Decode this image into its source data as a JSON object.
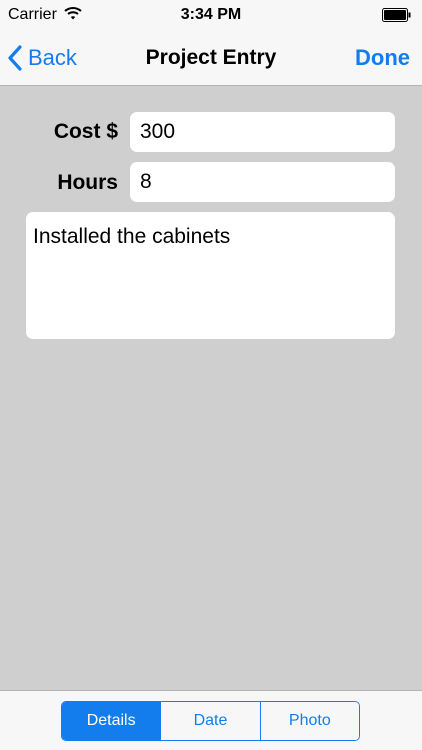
{
  "status_bar": {
    "carrier": "Carrier",
    "time": "3:34 PM",
    "wifi_icon": "wifi-icon",
    "battery_icon": "battery-icon"
  },
  "nav_bar": {
    "back_label": "Back",
    "title": "Project Entry",
    "done_label": "Done"
  },
  "form": {
    "cost": {
      "label": "Cost $",
      "value": "300"
    },
    "hours": {
      "label": "Hours",
      "value": "8"
    },
    "notes": {
      "value": "Installed the cabinets"
    }
  },
  "tabs": [
    {
      "label": "Details",
      "selected": true
    },
    {
      "label": "Date",
      "selected": false
    },
    {
      "label": "Photo",
      "selected": false
    }
  ],
  "colors": {
    "accent": "#137dee",
    "background": "#cfcfcf",
    "bar_background": "#f7f7f7"
  }
}
